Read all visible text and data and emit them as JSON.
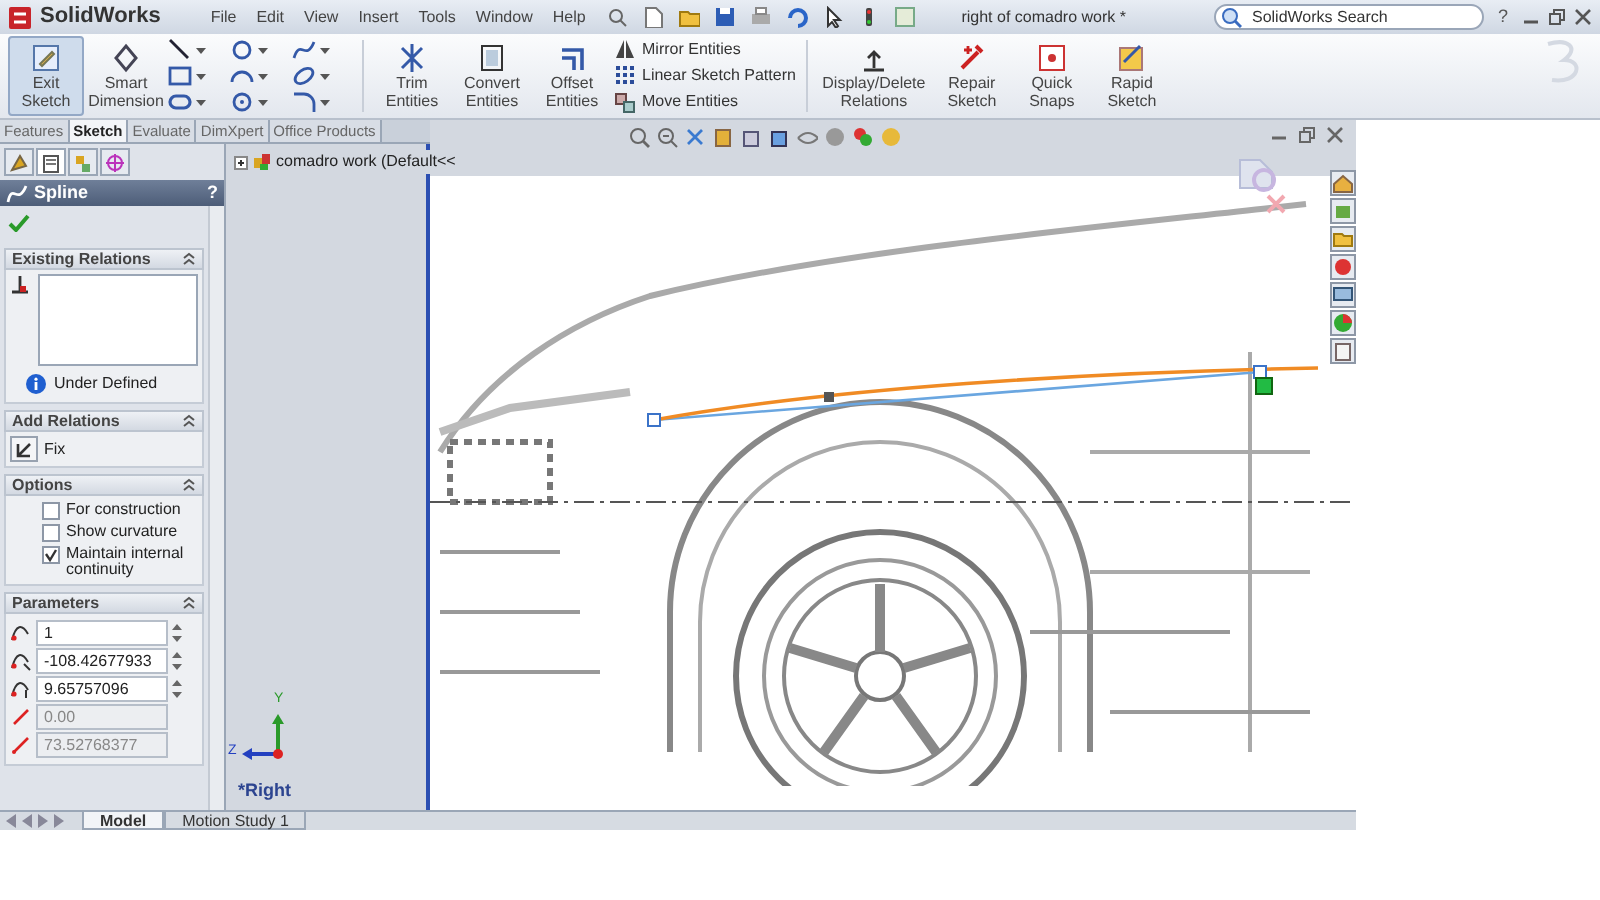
{
  "app": {
    "name": "SolidWorks"
  },
  "menu": [
    "File",
    "Edit",
    "View",
    "Insert",
    "Tools",
    "Window",
    "Help"
  ],
  "document_title": "right  of comadro work *",
  "search": {
    "placeholder": "SolidWorks Search"
  },
  "help": "?",
  "ribbon": {
    "buttons": [
      {
        "label": "Exit Sketch",
        "selected": true
      },
      {
        "label": "Smart Dimension",
        "selected": false
      },
      {
        "label": "Trim Entities",
        "selected": false
      },
      {
        "label": "Convert Entities",
        "selected": false
      },
      {
        "label": "Offset Entities",
        "selected": false
      }
    ],
    "list_tools": [
      "Mirror Entities",
      "Linear Sketch Pattern",
      "Move Entities"
    ],
    "buttons_right": [
      {
        "label": "Display/Delete Relations",
        "selected": false
      },
      {
        "label": "Repair Sketch",
        "selected": false
      },
      {
        "label": "Quick Snaps",
        "selected": false
      },
      {
        "label": "Rapid Sketch",
        "selected": false
      }
    ]
  },
  "command_tabs": [
    {
      "label": "Features",
      "selected": false
    },
    {
      "label": "Sketch",
      "selected": true
    },
    {
      "label": "Evaluate",
      "selected": false
    },
    {
      "label": "DimXpert",
      "selected": false
    },
    {
      "label": "Office Products",
      "selected": false
    }
  ],
  "property_manager": {
    "title": "Spline",
    "help": "?",
    "existing_relations": {
      "title": "Existing Relations",
      "status": "Under Defined"
    },
    "add_relations": {
      "title": "Add Relations",
      "buttons": [
        "Fix"
      ]
    },
    "options": {
      "title": "Options",
      "checkboxes": [
        {
          "label": "For construction",
          "checked": false
        },
        {
          "label": "Show curvature",
          "checked": false
        },
        {
          "label": "Maintain internal continuity",
          "checked": true
        }
      ]
    },
    "parameters": {
      "title": "Parameters",
      "fields": [
        {
          "value": "1",
          "disabled": false
        },
        {
          "value": "-108.42677933",
          "disabled": false
        },
        {
          "value": "9.65757096",
          "disabled": false
        },
        {
          "value": "0.00",
          "disabled": true
        },
        {
          "value": "73.52768377",
          "disabled": true
        }
      ]
    }
  },
  "tree": {
    "root": "comadro work  (Default<<"
  },
  "triad": {
    "axes": [
      "Y",
      "Z"
    ]
  },
  "view_name": "*Right",
  "bottom_tabs": [
    {
      "label": "Model",
      "selected": true
    },
    {
      "label": "Motion Study 1",
      "selected": false
    }
  ]
}
